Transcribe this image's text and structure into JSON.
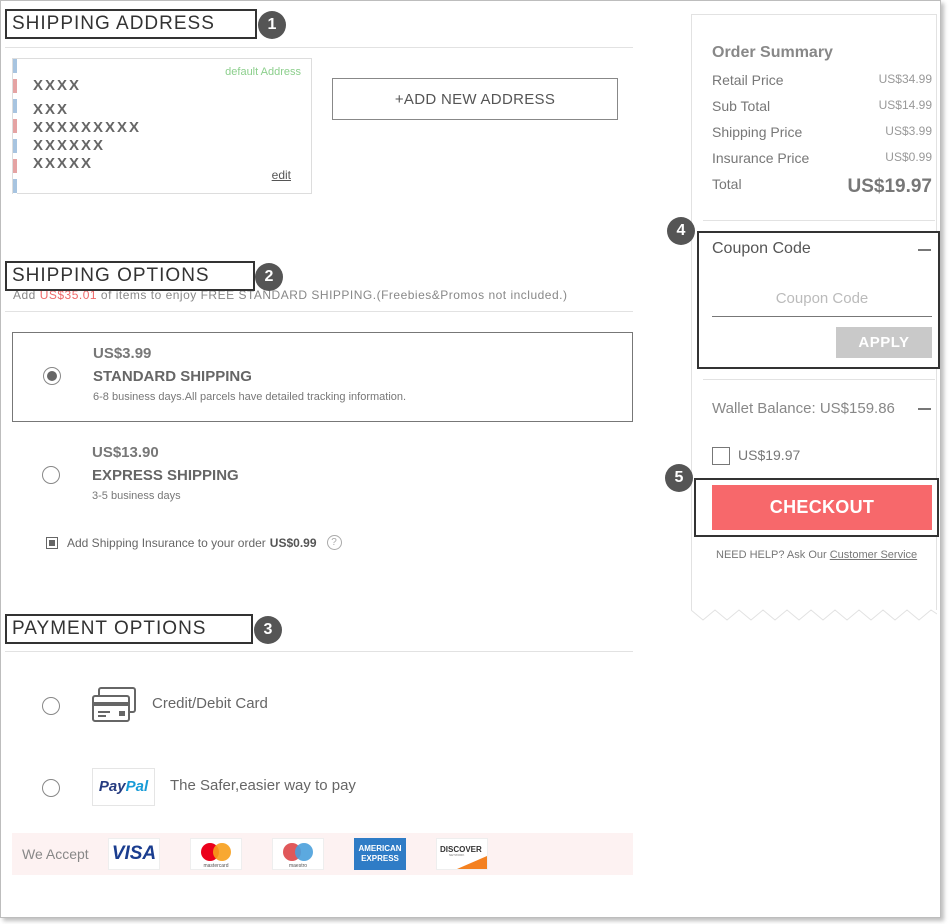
{
  "shipping_address": {
    "title": "SHIPPING ADDRESS",
    "badge": "1",
    "card": {
      "default_label": "default Address",
      "lines": [
        "XXXX",
        "XXX",
        "XXXXXXXXX",
        "XXXXXX",
        "XXXXX"
      ],
      "edit_label": "edit"
    },
    "add_button": "+ADD NEW ADDRESS"
  },
  "shipping_options": {
    "title": "SHIPPING OPTIONS",
    "badge": "2",
    "note_prefix": "Add ",
    "note_amount": "US$35.01",
    "note_suffix": " of items to enjoy FREE STANDARD SHIPPING.(Freebies&Promos not included.)",
    "options": [
      {
        "price": "US$3.99",
        "name": "STANDARD SHIPPING",
        "desc": "6-8 business days.All parcels have detailed tracking information.",
        "selected": true
      },
      {
        "price": "US$13.90",
        "name": "EXPRESS SHIPPING",
        "desc": "3-5 business days",
        "selected": false
      }
    ],
    "insurance": {
      "label": "Add Shipping Insurance to your order",
      "amount": "US$0.99",
      "help": "?",
      "checked": true
    }
  },
  "payment_options": {
    "title": "PAYMENT OPTIONS",
    "badge": "3",
    "methods": [
      {
        "label": "Credit/Debit Card",
        "icon": "credit-card-icon"
      },
      {
        "label": "The Safer,easier way to pay",
        "icon": "paypal-logo",
        "logo_part1": "Pay",
        "logo_part2": "Pal"
      }
    ],
    "we_accept": "We Accept",
    "cards": {
      "visa": "VISA",
      "mastercard": "mastercard",
      "maestro": "maestro",
      "amex_1": "AMERICAN",
      "amex_2": "EXPRESS",
      "discover": "DISCOVER",
      "discover_sub": "NETWORK"
    }
  },
  "order_summary": {
    "title": "Order Summary",
    "rows": [
      {
        "label": "Retail Price",
        "value": "US$34.99"
      },
      {
        "label": "Sub Total",
        "value": "US$14.99"
      },
      {
        "label": "Shipping Price",
        "value": "US$3.99"
      },
      {
        "label": "Insurance Price",
        "value": "US$0.99"
      }
    ],
    "total_label": "Total",
    "total_value": "US$19.97"
  },
  "coupon": {
    "badge": "4",
    "title": "Coupon Code",
    "placeholder": "Coupon Code",
    "apply_label": "APPLY"
  },
  "wallet": {
    "label": "Wallet Balance: US$159.86",
    "amount": "US$19.97",
    "checked": false
  },
  "checkout": {
    "badge": "5",
    "label": "CHECKOUT",
    "help_prefix": "NEED HELP? Ask Our ",
    "help_link": "Customer Service"
  },
  "colors": {
    "checkout_bg": "#f7686b",
    "apply_bg": "#c9c9c9",
    "default_address": "#8ccf8c",
    "note_amount": "#f06a6a",
    "accept_strip": "#fdf2f2"
  }
}
